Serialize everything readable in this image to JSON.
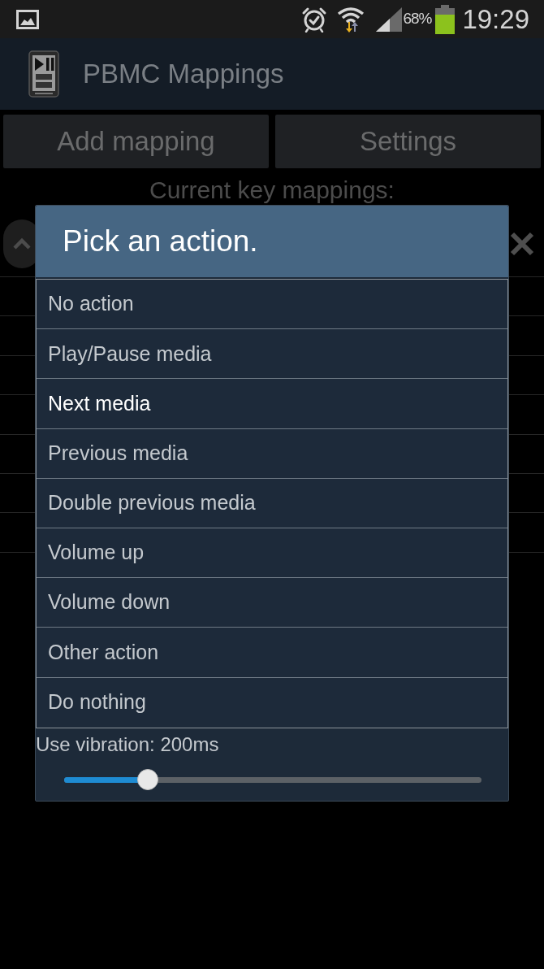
{
  "status_bar": {
    "battery": "68%",
    "time": "19:29"
  },
  "app_bar": {
    "title": "PBMC Mappings"
  },
  "buttons": [
    {
      "label": "Add mapping"
    },
    {
      "label": "Settings"
    }
  ],
  "mappings_heading": "Current key mappings:",
  "dialog": {
    "title": "Pick an action.",
    "options": [
      {
        "label": "No action",
        "selected": false
      },
      {
        "label": "Play/Pause media",
        "selected": false
      },
      {
        "label": "Next media",
        "selected": true
      },
      {
        "label": "Previous media",
        "selected": false
      },
      {
        "label": "Double previous media",
        "selected": false
      },
      {
        "label": "Volume up",
        "selected": false
      },
      {
        "label": "Volume down",
        "selected": false
      },
      {
        "label": "Other action",
        "selected": false
      },
      {
        "label": "Do nothing",
        "selected": false
      }
    ],
    "vibration": {
      "label": "Use vibration: 200ms",
      "level": 0.2
    }
  }
}
